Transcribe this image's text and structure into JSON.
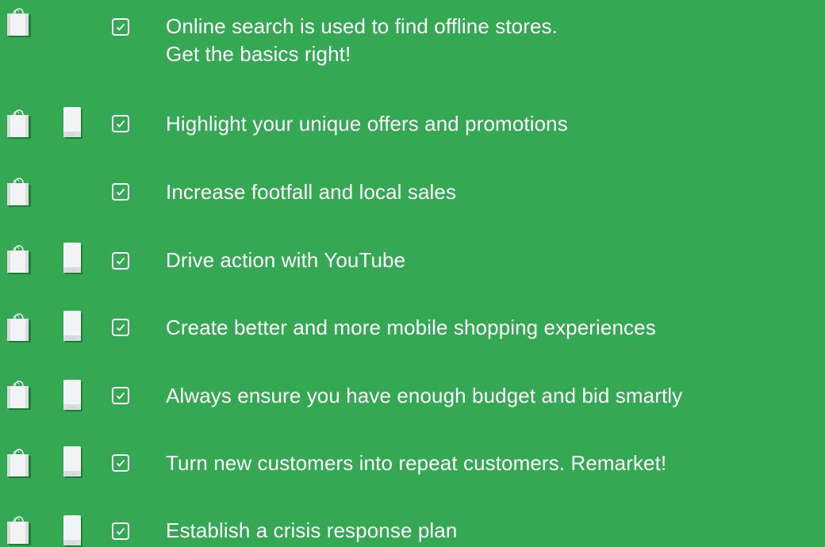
{
  "colors": {
    "background": "#34a853",
    "text": "#ffffff",
    "icon_fill": "#f1f3f4",
    "icon_shade": "#dadce0",
    "icon_shadow": "#1e7e34"
  },
  "checklist": {
    "items": [
      {
        "lines": [
          "Online search is used to find offline stores.",
          "Get the basics right!"
        ],
        "icons": [
          "shopping-bag-icon",
          "checkbox-checked-icon"
        ],
        "checked": true
      },
      {
        "lines": [
          "Highlight your unique offers and promotions"
        ],
        "icons": [
          "shopping-bag-icon",
          "smartphone-icon",
          "checkbox-checked-icon"
        ],
        "checked": true
      },
      {
        "lines": [
          "Increase footfall and local sales"
        ],
        "icons": [
          "shopping-bag-icon",
          "checkbox-checked-icon"
        ],
        "checked": true
      },
      {
        "lines": [
          "Drive action with YouTube"
        ],
        "icons": [
          "shopping-bag-icon",
          "smartphone-icon",
          "checkbox-checked-icon"
        ],
        "checked": true
      },
      {
        "lines": [
          "Create better and more mobile shopping experiences"
        ],
        "icons": [
          "shopping-bag-icon",
          "smartphone-icon",
          "checkbox-checked-icon"
        ],
        "checked": true
      },
      {
        "lines": [
          "Always ensure you have enough budget and bid smartly"
        ],
        "icons": [
          "shopping-bag-icon",
          "smartphone-icon",
          "checkbox-checked-icon"
        ],
        "checked": true
      },
      {
        "lines": [
          "Turn new customers into repeat customers. Remarket!"
        ],
        "icons": [
          "shopping-bag-icon",
          "smartphone-icon",
          "checkbox-checked-icon"
        ],
        "checked": true
      },
      {
        "lines": [
          "Establish a crisis response plan"
        ],
        "icons": [
          "shopping-bag-icon",
          "smartphone-icon",
          "checkbox-checked-icon"
        ],
        "checked": true
      }
    ]
  }
}
